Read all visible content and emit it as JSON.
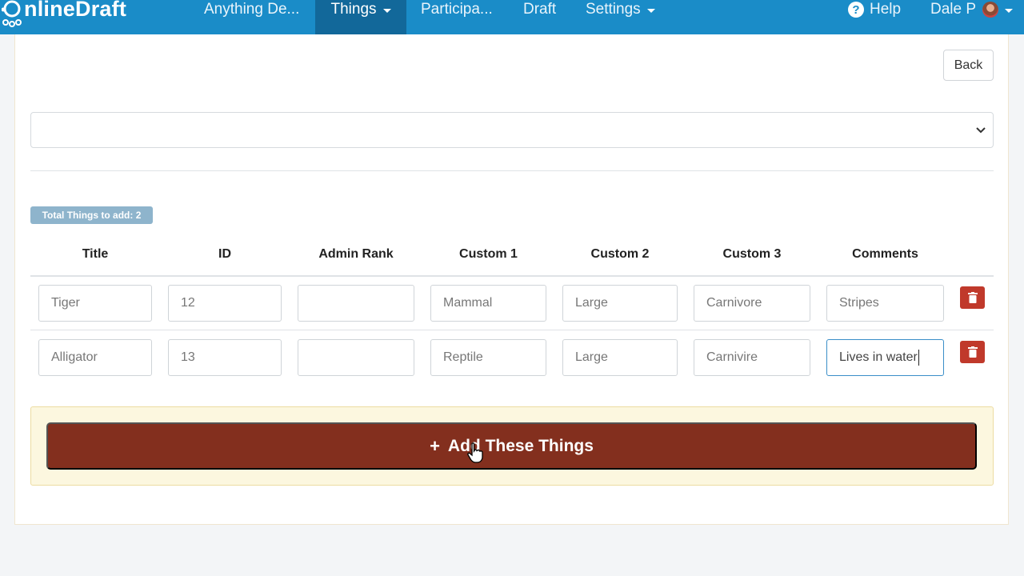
{
  "navbar": {
    "brand": "nlineDraft",
    "items": [
      {
        "label": "Anything De...",
        "has_caret": false
      },
      {
        "label": "Things",
        "has_caret": true,
        "active": true
      },
      {
        "label": "Participa...",
        "has_caret": false
      },
      {
        "label": "Draft",
        "has_caret": false
      },
      {
        "label": "Settings",
        "has_caret": true
      }
    ],
    "help": "Help",
    "user": "Dale P"
  },
  "back_label": "Back",
  "total_badge": "Total Things to add: 2",
  "table": {
    "headers": [
      "Title",
      "ID",
      "Admin Rank",
      "Custom 1",
      "Custom 2",
      "Custom 3",
      "Comments"
    ],
    "rows": [
      [
        "Tiger",
        "12",
        "",
        "Mammal",
        "Large",
        "Carnivore",
        "Stripes"
      ],
      [
        "Alligator",
        "13",
        "",
        "Reptile",
        "Large",
        "Carnivire",
        "Lives in water"
      ]
    ]
  },
  "add_button_label": "Add These Things",
  "colors": {
    "navbar": "#1a8cc8",
    "add_button": "#832f1e",
    "trash_button": "#c0392b",
    "badge": "#8eb4cc"
  }
}
